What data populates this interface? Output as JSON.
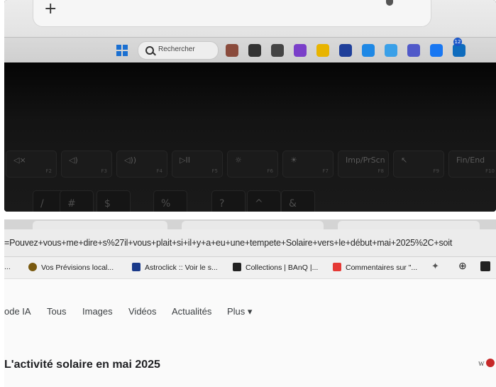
{
  "taskbar": {
    "search_placeholder": "Rechercher",
    "notification_count": "12",
    "apps": [
      "people-app",
      "store-app",
      "media-app",
      "photos-app",
      "files-app",
      "mail-app",
      "edge-app",
      "copilot-app",
      "teams-app",
      "facebook-app",
      "outlook-app"
    ],
    "app_colors": [
      "#8a4b3c",
      "#333333",
      "#444444",
      "#7a3fc9",
      "#e8b400",
      "#1f3f9a",
      "#1e88e5",
      "#3aa0e8",
      "#5059c9",
      "#1877f2",
      "#0f6cbd"
    ]
  },
  "keyboard": {
    "function_keys": [
      {
        "symbol": "◁×",
        "fn": "F2"
      },
      {
        "symbol": "◁)",
        "fn": "F3"
      },
      {
        "symbol": "◁))",
        "fn": "F4"
      },
      {
        "symbol": "▷II",
        "fn": "F5"
      },
      {
        "symbol": "☼",
        "fn": "F6"
      },
      {
        "symbol": "☀",
        "fn": "F7"
      },
      {
        "symbol": "Imp/PrScn",
        "fn": "F8"
      },
      {
        "symbol": "↖",
        "fn": "F9"
      },
      {
        "symbol": "Fin/End",
        "fn": "F10"
      }
    ],
    "number_keys": [
      "/",
      "#",
      "$",
      "%",
      "?",
      "^",
      "&"
    ]
  },
  "browser": {
    "url": "=Pouvez+vous+me+dire+s%27il+vous+plait+si+il+y+a+eu+une+tempete+Solaire+vers+le+début+mai+2025%2C+soit",
    "bookmarks": [
      {
        "label": "...",
        "icon": "bookmark-dot",
        "color": "#999999"
      },
      {
        "label": "Vos Prévisions local...",
        "icon": "weather-icon",
        "color": "#7a5a10"
      },
      {
        "label": "Astroclick :: Voir le s...",
        "icon": "astroclick-icon",
        "color": "#1a3a8a"
      },
      {
        "label": "Collections | BAnQ |...",
        "icon": "banq-icon",
        "color": "#222222"
      },
      {
        "label": "Commentaires sur \"...",
        "icon": "youtube-icon",
        "color": "#e53935"
      }
    ],
    "search_tabs": [
      "ode IA",
      "Tous",
      "Images",
      "Vidéos",
      "Actualités",
      "Plus ▾"
    ],
    "result_title": "L'activité solaire en mai 2025",
    "corner_text": "w"
  }
}
